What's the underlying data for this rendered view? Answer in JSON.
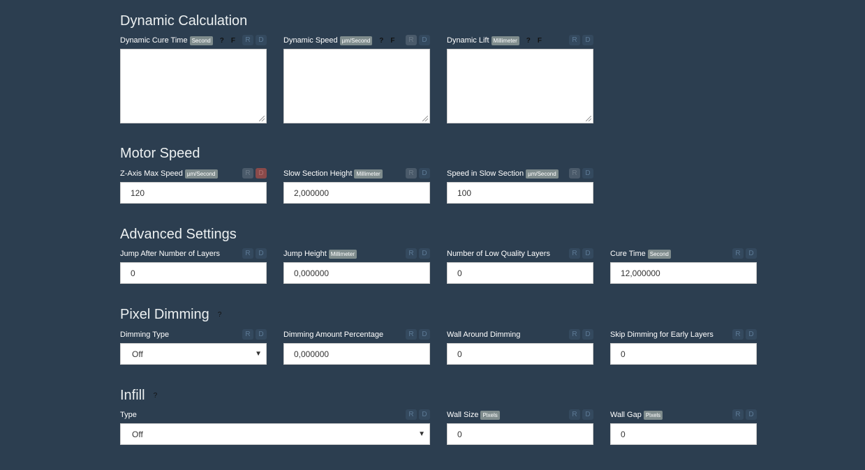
{
  "sections": {
    "dynamic": {
      "title": "Dynamic Calculation",
      "fields": [
        {
          "label": "Dynamic Cure Time",
          "unit": "Second",
          "help": "?",
          "flag": "F"
        },
        {
          "label": "Dynamic Speed",
          "unit": "µm/Second",
          "help": "?",
          "flag": "F"
        },
        {
          "label": "Dynamic Lift",
          "unit": "Millimeter",
          "help": "?",
          "flag": "F"
        }
      ]
    },
    "motor": {
      "title": "Motor Speed",
      "fields": [
        {
          "label": "Z-Axis Max Speed",
          "unit": "µm/Second",
          "value": "120"
        },
        {
          "label": "Slow Section Height",
          "unit": "Millimeter",
          "value": "2,000000"
        },
        {
          "label": "Speed in Slow Section",
          "unit": "µm/Second",
          "value": "100"
        }
      ]
    },
    "advanced": {
      "title": "Advanced Settings",
      "fields": [
        {
          "label": "Jump After Number of Layers",
          "value": "0"
        },
        {
          "label": "Jump Height",
          "unit": "Millimeter",
          "value": "0,000000"
        },
        {
          "label": "Number of Low Quality Layers",
          "value": "0"
        },
        {
          "label": "Cure Time",
          "unit": "Second",
          "value": "12,000000"
        }
      ]
    },
    "dimming": {
      "title": "Pixel Dimming",
      "help": "?",
      "fields": [
        {
          "label": "Dimming Type",
          "value": "Off"
        },
        {
          "label": "Dimming Amount Percentage",
          "value": "0,000000"
        },
        {
          "label": "Wall Around Dimming",
          "value": "0"
        },
        {
          "label": "Skip Dimming for Early Layers",
          "value": "0"
        }
      ]
    },
    "infill": {
      "title": "Infill",
      "help": "?",
      "fields": [
        {
          "label": "Type",
          "value": "Off"
        },
        {
          "label": "Wall Size",
          "unit": "Pixels",
          "value": "0"
        },
        {
          "label": "Wall Gap",
          "unit": "Pixels",
          "value": "0"
        }
      ]
    }
  },
  "buttons": {
    "reset": "R",
    "default": "D"
  },
  "icons": {
    "dropdown": "chevron-down-icon",
    "resize": "resize-grip-icon"
  }
}
